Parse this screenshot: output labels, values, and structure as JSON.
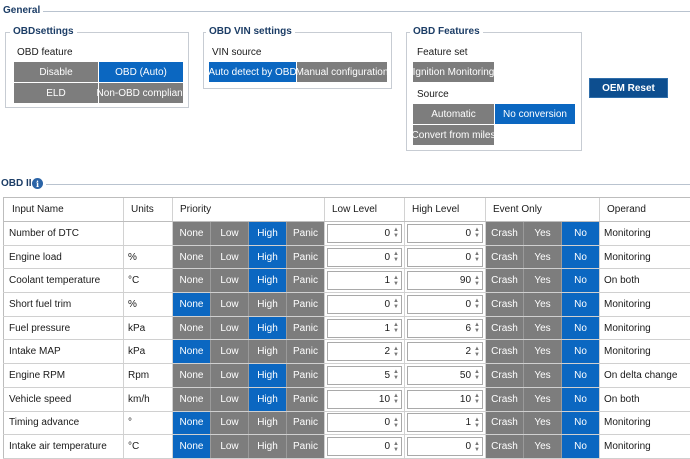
{
  "general": {
    "title": "General",
    "obd_settings": {
      "title": "OBDsettings",
      "feature_label": "OBD feature",
      "options": [
        {
          "label": "Disable",
          "active": false
        },
        {
          "label": "OBD (Auto)",
          "active": true
        },
        {
          "label": "ELD",
          "active": false
        },
        {
          "label": "Non-OBD compliant",
          "active": false
        }
      ]
    },
    "vin_settings": {
      "title": "OBD VIN settings",
      "source_label": "VIN source",
      "options": [
        {
          "label": "Auto detect by OBD",
          "active": true
        },
        {
          "label": "Manual configuration",
          "active": false
        }
      ]
    },
    "obd_features": {
      "title": "OBD Features",
      "feature_set_label": "Feature set",
      "feature_set_option": "Ignition Monitoring",
      "source_label": "Source",
      "options": [
        {
          "label": "Automatic",
          "active": false
        },
        {
          "label": "No conversion",
          "active": true
        },
        {
          "label": "Convert from miles",
          "active": false
        }
      ]
    },
    "oem_reset_label": "OEM Reset"
  },
  "obd2": {
    "title": "OBD II",
    "info_glyph": "i",
    "columns": [
      "Input Name",
      "Units",
      "Priority",
      "Low Level",
      "High Level",
      "Event Only",
      "Operand"
    ],
    "priority_options": [
      "None",
      "Low",
      "High",
      "Panic"
    ],
    "event_options": [
      "Crash",
      "Yes",
      "No"
    ],
    "rows": [
      {
        "name": "Number of DTC",
        "units": "",
        "priority": "High",
        "low": "0",
        "high": "0",
        "event": "No",
        "operand": "Monitoring"
      },
      {
        "name": "Engine load",
        "units": "%",
        "priority": "High",
        "low": "0",
        "high": "0",
        "event": "No",
        "operand": "Monitoring"
      },
      {
        "name": "Coolant temperature",
        "units": "°C",
        "priority": "High",
        "low": "1",
        "high": "90",
        "event": "No",
        "operand": "On both"
      },
      {
        "name": "Short fuel trim",
        "units": "%",
        "priority": "None",
        "low": "0",
        "high": "0",
        "event": "No",
        "operand": "Monitoring"
      },
      {
        "name": "Fuel pressure",
        "units": "kPa",
        "priority": "High",
        "low": "1",
        "high": "6",
        "event": "No",
        "operand": "Monitoring"
      },
      {
        "name": "Intake MAP",
        "units": "kPa",
        "priority": "None",
        "low": "2",
        "high": "2",
        "event": "No",
        "operand": "Monitoring"
      },
      {
        "name": "Engine RPM",
        "units": "Rpm",
        "priority": "High",
        "low": "5",
        "high": "50",
        "event": "No",
        "operand": "On delta change"
      },
      {
        "name": "Vehicle speed",
        "units": "km/h",
        "priority": "High",
        "low": "10",
        "high": "10",
        "event": "No",
        "operand": "On both"
      },
      {
        "name": "Timing advance",
        "units": "°",
        "priority": "None",
        "low": "0",
        "high": "1",
        "event": "No",
        "operand": "Monitoring"
      },
      {
        "name": "Intake air temperature",
        "units": "°C",
        "priority": "None",
        "low": "0",
        "high": "0",
        "event": "No",
        "operand": "Monitoring"
      }
    ]
  },
  "colors": {
    "active": "#0b67c1",
    "inactive": "#7d7d7d",
    "title": "#1c3d66",
    "oem_button": "#0d4e8f"
  }
}
